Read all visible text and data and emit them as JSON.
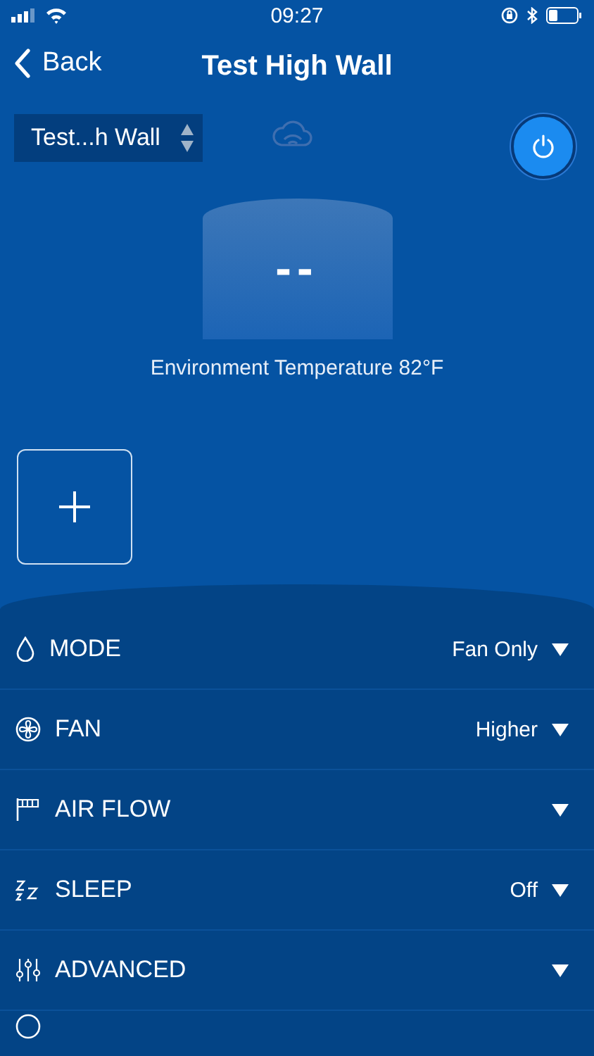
{
  "status_bar": {
    "time": "09:27"
  },
  "nav": {
    "back": "Back",
    "title": "Test High Wall"
  },
  "device_picker": {
    "value": "Test...h Wall"
  },
  "power": {
    "on": true
  },
  "temperature": {
    "display": "--",
    "environment": "Environment Temperature 82°F"
  },
  "settings": [
    {
      "kind": "mode",
      "label": "MODE",
      "value": "Fan Only"
    },
    {
      "kind": "fan",
      "label": "FAN",
      "value": "Higher"
    },
    {
      "kind": "airflow",
      "label": "AIR FLOW"
    },
    {
      "kind": "sleep",
      "label": "SLEEP",
      "value": "Off"
    },
    {
      "kind": "advanced",
      "label": "ADVANCED"
    }
  ]
}
